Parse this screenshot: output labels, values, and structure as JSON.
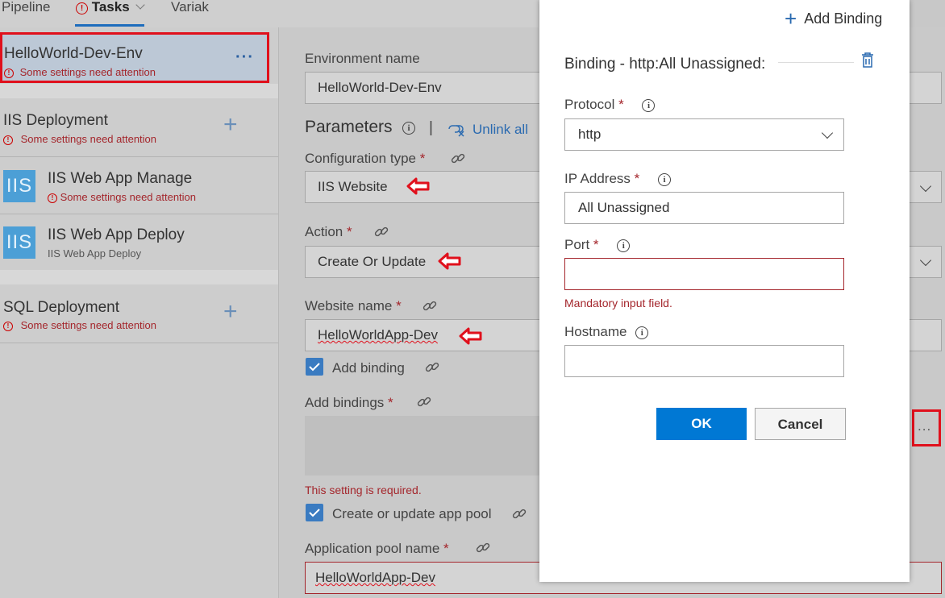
{
  "tabs": {
    "pipeline": "Pipeline",
    "tasks": "Tasks",
    "variables": "Variak"
  },
  "sidebar": {
    "environment": {
      "title": "HelloWorld-Dev-Env",
      "warning": "Some settings need attention"
    },
    "iis_deployment": {
      "title": "IIS Deployment",
      "warning": "Some settings need attention"
    },
    "iis_manage": {
      "title": "IIS Web App Manage",
      "warning": "Some settings need attention",
      "tile": "IIS"
    },
    "iis_deploy": {
      "title": "IIS Web App Deploy",
      "subtitle": "IIS Web App Deploy",
      "tile": "IIS"
    },
    "sql_deployment": {
      "title": "SQL Deployment",
      "warning": "Some settings need attention"
    }
  },
  "form": {
    "environment_name_label": "Environment name",
    "environment_name_value": "HelloWorld-Dev-Env",
    "parameters_heading": "Parameters",
    "separator": "|",
    "unlink_all": "Unlink all",
    "configuration_type_label": "Configuration type",
    "configuration_type_value": "IIS Website",
    "action_label": "Action",
    "action_value": "Create Or Update",
    "website_name_label": "Website name",
    "website_name_value": "HelloWorldApp-Dev",
    "add_binding_checkbox": "Add binding",
    "add_bindings_label": "Add bindings",
    "required_error": "This setting is required.",
    "app_pool_checkbox": "Create or update app pool",
    "app_pool_name_label": "Application pool name",
    "app_pool_name_value": "HelloWorldApp-Dev",
    "required_mark": "*",
    "ellipsis": "..."
  },
  "dialog": {
    "add_binding": "Add Binding",
    "title": "Binding - http:All Unassigned:",
    "protocol_label": "Protocol",
    "protocol_value": "http",
    "ip_label": "IP Address",
    "ip_value": "All Unassigned",
    "port_label": "Port",
    "port_value": "",
    "port_error": "Mandatory input field.",
    "hostname_label": "Hostname",
    "hostname_value": "",
    "ok": "OK",
    "cancel": "Cancel"
  },
  "colors": {
    "accent": "#0078d4",
    "error": "#a4262c",
    "highlight": "#e0101c"
  }
}
